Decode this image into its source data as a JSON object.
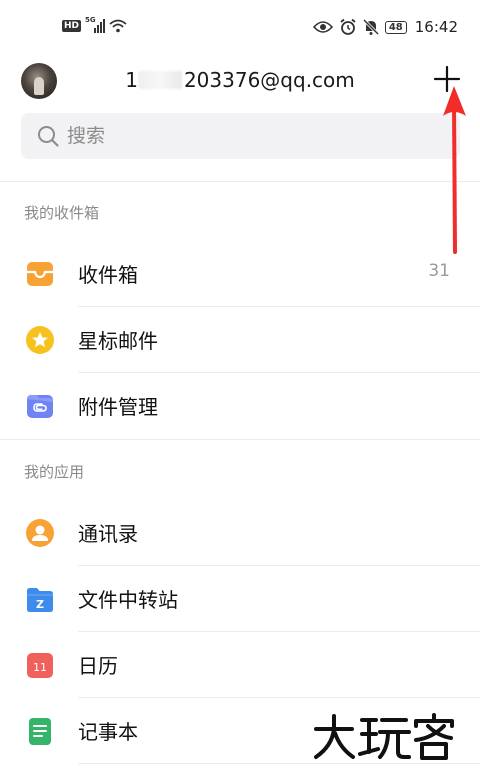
{
  "status_bar": {
    "hd": "HD",
    "network": "5G",
    "battery": "48",
    "time": "16:42"
  },
  "header": {
    "account_prefix": "1",
    "account_suffix": "203376@qq.com"
  },
  "search": {
    "placeholder": "搜索",
    "value": ""
  },
  "mailbox_section": {
    "title": "我的收件箱",
    "items": [
      {
        "label": "收件箱",
        "icon": "inbox-icon",
        "count": "31",
        "color": "#F7A234"
      },
      {
        "label": "星标邮件",
        "icon": "star-icon",
        "color": "#F7C21F"
      },
      {
        "label": "附件管理",
        "icon": "attachment-icon",
        "color": "#6F84F2"
      }
    ]
  },
  "apps_section": {
    "title": "我的应用",
    "items": [
      {
        "label": "通讯录",
        "icon": "contacts-icon",
        "color": "#F7A234"
      },
      {
        "label": "文件中转站",
        "icon": "folder-icon",
        "badge": "Z",
        "color": "#3D8BEA"
      },
      {
        "label": "日历",
        "icon": "calendar-icon",
        "badge": "11",
        "color": "#F0605D"
      },
      {
        "label": "记事本",
        "icon": "notepad-icon",
        "color": "#35B56A"
      }
    ]
  },
  "watermark": "大玩客"
}
